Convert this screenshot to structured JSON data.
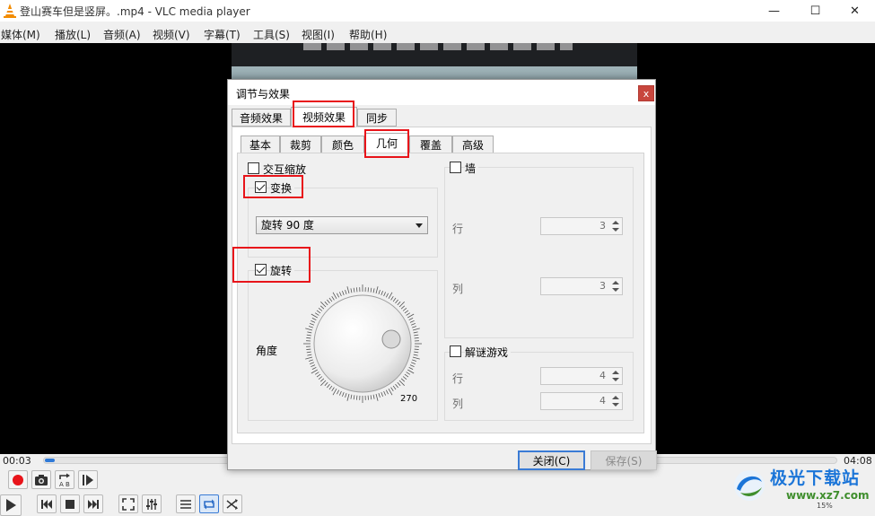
{
  "window": {
    "title": "登山赛车但是竖屏。.mp4 - VLC media player",
    "minimize_glyph": "—",
    "maximize_glyph": "☐",
    "close_glyph": "✕"
  },
  "menu": [
    "媒体(M)",
    "播放(L)",
    "音频(A)",
    "视频(V)",
    "字幕(T)",
    "工具(S)",
    "视图(I)",
    "帮助(H)"
  ],
  "player": {
    "elapsed": "00:03",
    "total": "04:08",
    "progress_fraction": 0.012,
    "volume_percent": "15%"
  },
  "controls": {
    "row1": [
      "record-icon",
      "snapshot-icon",
      "ab-loop-icon",
      "frame-step-icon"
    ],
    "row2": [
      "play-icon",
      "previous-icon",
      "stop-icon",
      "next-icon",
      "fullscreen-icon",
      "extended-settings-icon",
      "playlist-icon",
      "loop-icon",
      "shuffle-icon"
    ]
  },
  "dialog": {
    "title": "调节与效果",
    "close_glyph": "x",
    "tabs": [
      "音频效果",
      "视频效果",
      "同步"
    ],
    "selected_tab": "视频效果",
    "subtabs": [
      "基本",
      "裁剪",
      "颜色",
      "几何",
      "覆盖",
      "高级"
    ],
    "selected_subtab": "几何",
    "interactive_zoom": {
      "label": "交互缩放",
      "checked": false
    },
    "transform": {
      "label": "变换",
      "checked": true,
      "select_value": "旋转 90 度"
    },
    "rotate": {
      "label": "旋转",
      "checked": true,
      "angle_label": "角度",
      "dial_value": "270"
    },
    "wall": {
      "label": "墙",
      "checked": false,
      "rows_label": "行",
      "rows_value": "3",
      "cols_label": "列",
      "cols_value": "3"
    },
    "puzzle": {
      "label": "解谜游戏",
      "checked": false,
      "rows_label": "行",
      "rows_value": "4",
      "cols_label": "列",
      "cols_value": "4"
    },
    "buttons": {
      "close": "关闭(C)",
      "save": "保存(S)"
    }
  },
  "watermark": {
    "title": "极光下载站",
    "url": "www.xz7.com"
  },
  "colors": {
    "accent": "#2f7ad8",
    "highlight": "#e8141a",
    "record": "#e8141a"
  }
}
